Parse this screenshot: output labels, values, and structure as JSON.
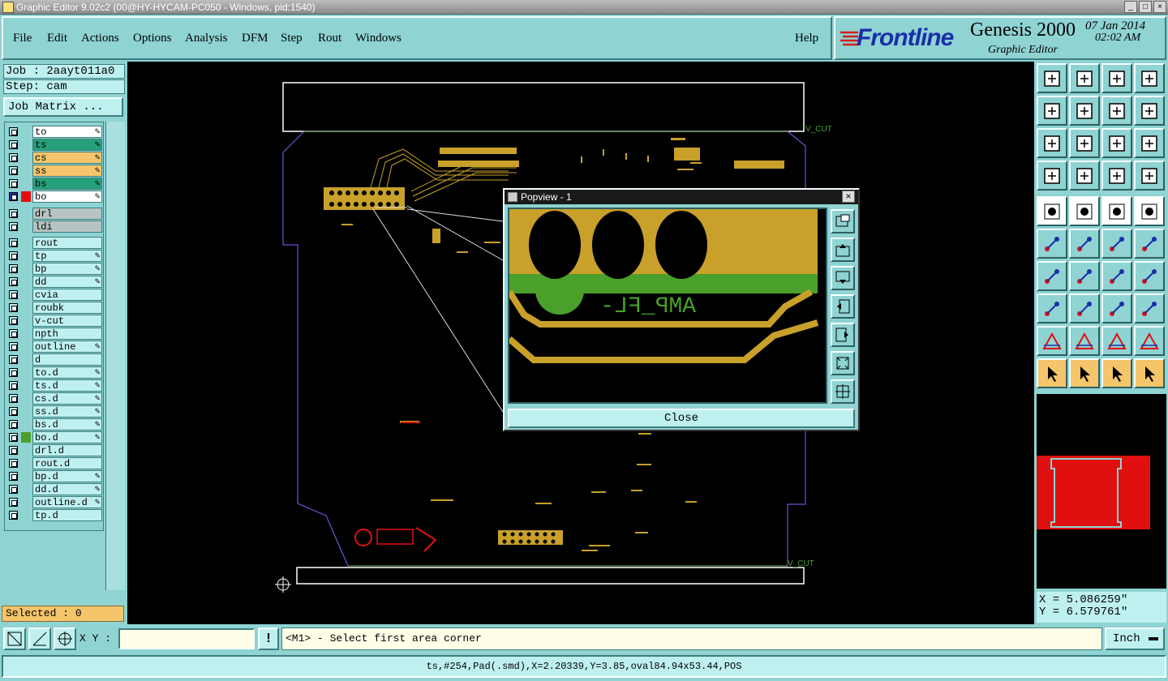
{
  "window": {
    "title": "Graphic Editor 9.02c2 (00@HY-HYCAM-PC050 - Windows, pid:1540)"
  },
  "menu": {
    "items": [
      "File",
      "Edit",
      "Actions",
      "Options",
      "Analysis",
      "DFM",
      "Step",
      "Rout",
      "Windows"
    ],
    "help": "Help"
  },
  "logo": {
    "brand": "Frontline",
    "product": "Genesis 2000",
    "subtitle": "Graphic Editor",
    "date": "07 Jan 2014",
    "time": "02:02 AM"
  },
  "job": {
    "job_label": "Job : 2aayt011a0",
    "step_label": "Step: cam",
    "matrix_button": "Job Matrix ..."
  },
  "layers": [
    {
      "name": "to",
      "color": "#ffffff",
      "edit": true
    },
    {
      "name": "ts",
      "color": "#26a07a",
      "edit": true
    },
    {
      "name": "cs",
      "color": "#f4c56b",
      "edit": true
    },
    {
      "name": "ss",
      "color": "#f4c56b",
      "edit": true
    },
    {
      "name": "bs",
      "color": "#26a07a",
      "edit": true
    },
    {
      "name": "bo",
      "color": "#ffffff",
      "edit": true,
      "work": true
    },
    {
      "name": "drl",
      "color": "#b8c4c4"
    },
    {
      "name": "ldi",
      "color": "#b8c4c4"
    },
    {
      "name": "rout",
      "color": "#bff0f0"
    },
    {
      "name": "tp",
      "color": "#bff0f0",
      "edit": true
    },
    {
      "name": "bp",
      "color": "#bff0f0",
      "edit": true
    },
    {
      "name": "dd",
      "color": "#bff0f0",
      "edit": true
    },
    {
      "name": "cvia",
      "color": "#bff0f0"
    },
    {
      "name": "roubk",
      "color": "#bff0f0"
    },
    {
      "name": "v-cut",
      "color": "#bff0f0"
    },
    {
      "name": "npth",
      "color": "#bff0f0"
    },
    {
      "name": "outline",
      "color": "#bff0f0",
      "edit": true
    },
    {
      "name": "d",
      "color": "#bff0f0"
    },
    {
      "name": "to.d",
      "color": "#bff0f0",
      "edit": true
    },
    {
      "name": "ts.d",
      "color": "#bff0f0",
      "edit": true
    },
    {
      "name": "cs.d",
      "color": "#bff0f0",
      "edit": true
    },
    {
      "name": "ss.d",
      "color": "#bff0f0",
      "edit": true
    },
    {
      "name": "bs.d",
      "color": "#bff0f0",
      "edit": true
    },
    {
      "name": "bo.d",
      "color": "#bff0f0",
      "edit": true,
      "swatch": "#4aa02a"
    },
    {
      "name": "drl.d",
      "color": "#bff0f0"
    },
    {
      "name": "rout.d",
      "color": "#bff0f0"
    },
    {
      "name": "bp.d",
      "color": "#bff0f0",
      "edit": true
    },
    {
      "name": "dd.d",
      "color": "#bff0f0",
      "edit": true
    },
    {
      "name": "outline.d",
      "color": "#bff0f0",
      "edit": true
    },
    {
      "name": "tp.d",
      "color": "#bff0f0"
    }
  ],
  "selected": "Selected : 0",
  "canvas": {
    "vcut_top": "V_CUT",
    "vcut_bottom": "V_CUT"
  },
  "popview": {
    "title": "Popview - 1",
    "close_label": "Close",
    "silk_text": "AMP_FL-"
  },
  "coords": {
    "x": "X = 5.086259\"",
    "y": "Y = 6.579761\""
  },
  "cmd": {
    "xy_label": "X Y :",
    "prompt": "<M1> - Select first area corner",
    "unit": "Inch",
    "xy_value": ""
  },
  "status": "ts,#254,Pad(.smd),X=2.20339,Y=3.85,oval84.94x53.44,POS",
  "colors": {
    "panel": "#8fd3d3",
    "canvas": "#000000",
    "copper": "#c8a02a",
    "mask": "#4aa02a",
    "highlight": "#f4c56b"
  }
}
